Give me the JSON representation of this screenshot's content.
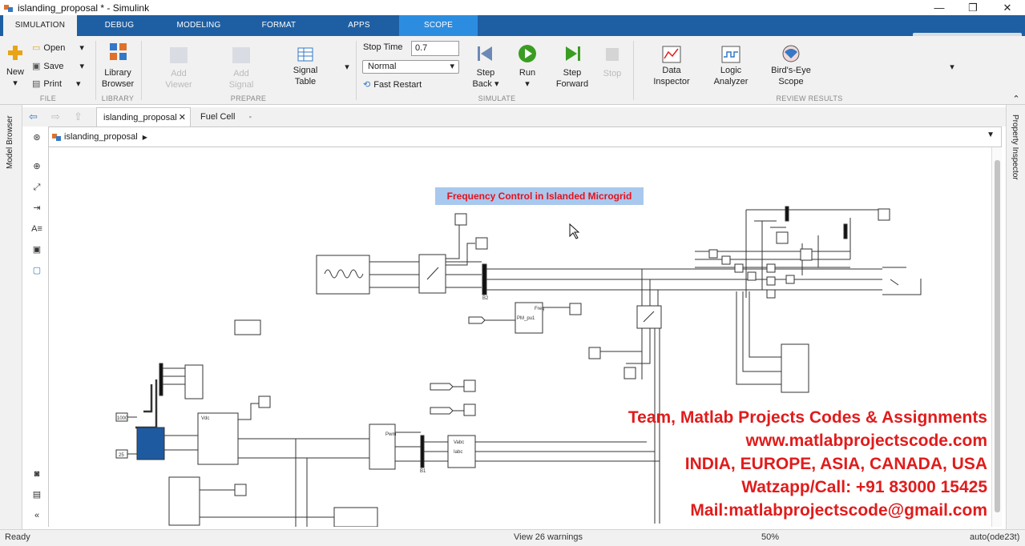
{
  "window": {
    "title": "islanding_proposal * - Simulink"
  },
  "tabs": [
    "SIMULATION",
    "DEBUG",
    "MODELING",
    "FORMAT",
    "APPS",
    "SCOPE"
  ],
  "ribbon": {
    "file": {
      "new_label": "New",
      "open_label": "Open",
      "save_label": "Save",
      "print_label": "Print",
      "section": "FILE"
    },
    "library": {
      "button_line1": "Library",
      "button_line2": "Browser",
      "section": "LIBRARY"
    },
    "prepare": {
      "add_viewer1": "Add",
      "add_viewer2": "Viewer",
      "add_signal1": "Add",
      "add_signal2": "Signal",
      "signal_table1": "Signal",
      "signal_table2": "Table",
      "section": "PREPARE"
    },
    "simulate": {
      "stop_time_label": "Stop Time",
      "stop_time_value": "0.7",
      "mode_value": "Normal",
      "fast_restart": "Fast Restart",
      "step_back1": "Step",
      "step_back2": "Back",
      "run": "Run",
      "step_forward1": "Step",
      "step_forward2": "Forward",
      "stop": "Stop",
      "section": "SIMULATE"
    },
    "review": {
      "data_inspector1": "Data",
      "data_inspector2": "Inspector",
      "logic_analyzer1": "Logic",
      "logic_analyzer2": "Analyzer",
      "birds_eye1": "Bird's-Eye",
      "birds_eye2": "Scope",
      "section": "REVIEW RESULTS"
    }
  },
  "side_panels": {
    "left": "Model Browser",
    "right": "Property Inspector"
  },
  "doc_tabs": [
    "islanding_proposal",
    "Fuel Cell"
  ],
  "breadcrumb": "islanding_proposal",
  "model": {
    "title": "Frequency Control in Islanded Microgrid",
    "block_labels": {
      "b2": "B2",
      "b1": "B1",
      "const_1000": "1000",
      "const_25": "25",
      "pmsm": "Freq",
      "pm_label": "PM_pu1",
      "vabc": "Vabc",
      "iabc": "Iabc",
      "pwm": "Pwm",
      "vdc": "Vdc"
    }
  },
  "watermark": [
    "Team, Matlab Projects Codes & Assignments",
    "www.matlabprojectscode.com",
    "INDIA, EUROPE, ASIA, CANADA, USA",
    "Watzapp/Call: +91 83000 15425",
    "Mail:matlabprojectscode@gmail.com"
  ],
  "status": {
    "ready": "Ready",
    "warnings": "View 26 warnings",
    "zoom": "50%",
    "solver": "auto(ode23t)"
  },
  "colors": {
    "tab_bar": "#1e5fa3",
    "scope_tab": "#2c8de0",
    "title_text": "#e8101a",
    "watermark": "#e01c1c"
  }
}
